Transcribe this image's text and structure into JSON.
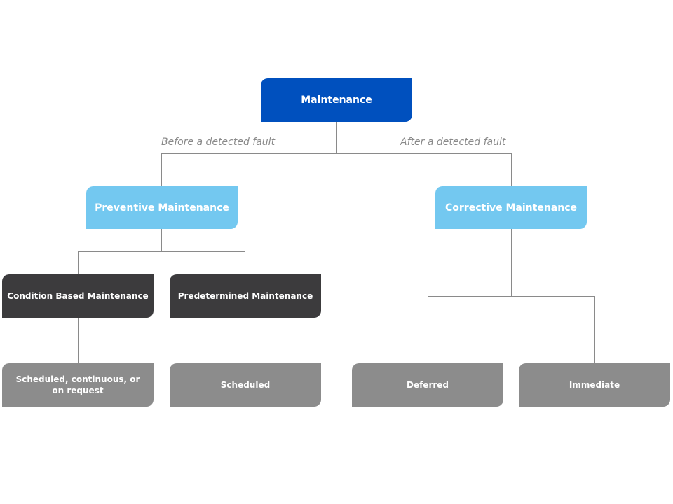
{
  "diagram": {
    "root": {
      "label": "Maintenance"
    },
    "edge_labels": {
      "left": "Before a detected fault",
      "right": "After a detected fault"
    },
    "preventive": {
      "label": "Preventive Maintenance",
      "children": [
        {
          "label": "Condition Based Maintenance",
          "leaf": "Scheduled, continuous, or on request"
        },
        {
          "label": "Predetermined Maintenance",
          "leaf": "Scheduled"
        }
      ]
    },
    "corrective": {
      "label": "Corrective Maintenance",
      "leaves": [
        "Deferred",
        "Immediate"
      ]
    },
    "colors": {
      "root": "#0050be",
      "level1": "#73c8f0",
      "level2": "#3c3b3d",
      "leaf": "#8c8c8c",
      "connector": "#8a8a8a"
    }
  }
}
